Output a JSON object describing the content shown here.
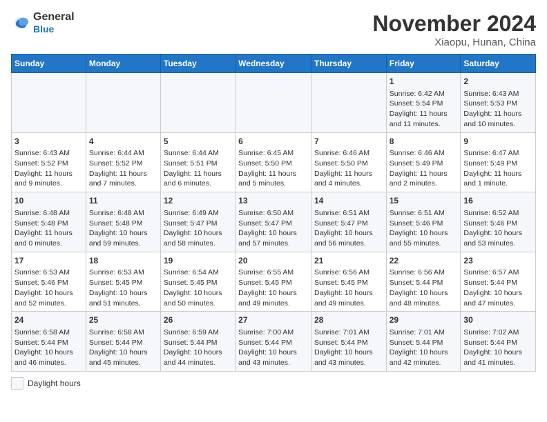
{
  "header": {
    "logo_line1": "General",
    "logo_line2": "Blue",
    "title": "November 2024",
    "subtitle": "Xiaopu, Hunan, China"
  },
  "columns": [
    "Sunday",
    "Monday",
    "Tuesday",
    "Wednesday",
    "Thursday",
    "Friday",
    "Saturday"
  ],
  "weeks": [
    [
      {
        "day": "",
        "info": ""
      },
      {
        "day": "",
        "info": ""
      },
      {
        "day": "",
        "info": ""
      },
      {
        "day": "",
        "info": ""
      },
      {
        "day": "",
        "info": ""
      },
      {
        "day": "1",
        "info": "Sunrise: 6:42 AM\nSunset: 5:54 PM\nDaylight: 11 hours and 11 minutes."
      },
      {
        "day": "2",
        "info": "Sunrise: 6:43 AM\nSunset: 5:53 PM\nDaylight: 11 hours and 10 minutes."
      }
    ],
    [
      {
        "day": "3",
        "info": "Sunrise: 6:43 AM\nSunset: 5:52 PM\nDaylight: 11 hours and 9 minutes."
      },
      {
        "day": "4",
        "info": "Sunrise: 6:44 AM\nSunset: 5:52 PM\nDaylight: 11 hours and 7 minutes."
      },
      {
        "day": "5",
        "info": "Sunrise: 6:44 AM\nSunset: 5:51 PM\nDaylight: 11 hours and 6 minutes."
      },
      {
        "day": "6",
        "info": "Sunrise: 6:45 AM\nSunset: 5:50 PM\nDaylight: 11 hours and 5 minutes."
      },
      {
        "day": "7",
        "info": "Sunrise: 6:46 AM\nSunset: 5:50 PM\nDaylight: 11 hours and 4 minutes."
      },
      {
        "day": "8",
        "info": "Sunrise: 6:46 AM\nSunset: 5:49 PM\nDaylight: 11 hours and 2 minutes."
      },
      {
        "day": "9",
        "info": "Sunrise: 6:47 AM\nSunset: 5:49 PM\nDaylight: 11 hours and 1 minute."
      }
    ],
    [
      {
        "day": "10",
        "info": "Sunrise: 6:48 AM\nSunset: 5:48 PM\nDaylight: 11 hours and 0 minutes."
      },
      {
        "day": "11",
        "info": "Sunrise: 6:48 AM\nSunset: 5:48 PM\nDaylight: 10 hours and 59 minutes."
      },
      {
        "day": "12",
        "info": "Sunrise: 6:49 AM\nSunset: 5:47 PM\nDaylight: 10 hours and 58 minutes."
      },
      {
        "day": "13",
        "info": "Sunrise: 6:50 AM\nSunset: 5:47 PM\nDaylight: 10 hours and 57 minutes."
      },
      {
        "day": "14",
        "info": "Sunrise: 6:51 AM\nSunset: 5:47 PM\nDaylight: 10 hours and 56 minutes."
      },
      {
        "day": "15",
        "info": "Sunrise: 6:51 AM\nSunset: 5:46 PM\nDaylight: 10 hours and 55 minutes."
      },
      {
        "day": "16",
        "info": "Sunrise: 6:52 AM\nSunset: 5:46 PM\nDaylight: 10 hours and 53 minutes."
      }
    ],
    [
      {
        "day": "17",
        "info": "Sunrise: 6:53 AM\nSunset: 5:46 PM\nDaylight: 10 hours and 52 minutes."
      },
      {
        "day": "18",
        "info": "Sunrise: 6:53 AM\nSunset: 5:45 PM\nDaylight: 10 hours and 51 minutes."
      },
      {
        "day": "19",
        "info": "Sunrise: 6:54 AM\nSunset: 5:45 PM\nDaylight: 10 hours and 50 minutes."
      },
      {
        "day": "20",
        "info": "Sunrise: 6:55 AM\nSunset: 5:45 PM\nDaylight: 10 hours and 49 minutes."
      },
      {
        "day": "21",
        "info": "Sunrise: 6:56 AM\nSunset: 5:45 PM\nDaylight: 10 hours and 49 minutes."
      },
      {
        "day": "22",
        "info": "Sunrise: 6:56 AM\nSunset: 5:44 PM\nDaylight: 10 hours and 48 minutes."
      },
      {
        "day": "23",
        "info": "Sunrise: 6:57 AM\nSunset: 5:44 PM\nDaylight: 10 hours and 47 minutes."
      }
    ],
    [
      {
        "day": "24",
        "info": "Sunrise: 6:58 AM\nSunset: 5:44 PM\nDaylight: 10 hours and 46 minutes."
      },
      {
        "day": "25",
        "info": "Sunrise: 6:58 AM\nSunset: 5:44 PM\nDaylight: 10 hours and 45 minutes."
      },
      {
        "day": "26",
        "info": "Sunrise: 6:59 AM\nSunset: 5:44 PM\nDaylight: 10 hours and 44 minutes."
      },
      {
        "day": "27",
        "info": "Sunrise: 7:00 AM\nSunset: 5:44 PM\nDaylight: 10 hours and 43 minutes."
      },
      {
        "day": "28",
        "info": "Sunrise: 7:01 AM\nSunset: 5:44 PM\nDaylight: 10 hours and 43 minutes."
      },
      {
        "day": "29",
        "info": "Sunrise: 7:01 AM\nSunset: 5:44 PM\nDaylight: 10 hours and 42 minutes."
      },
      {
        "day": "30",
        "info": "Sunrise: 7:02 AM\nSunset: 5:44 PM\nDaylight: 10 hours and 41 minutes."
      }
    ]
  ],
  "legend": {
    "label": "Daylight hours"
  }
}
